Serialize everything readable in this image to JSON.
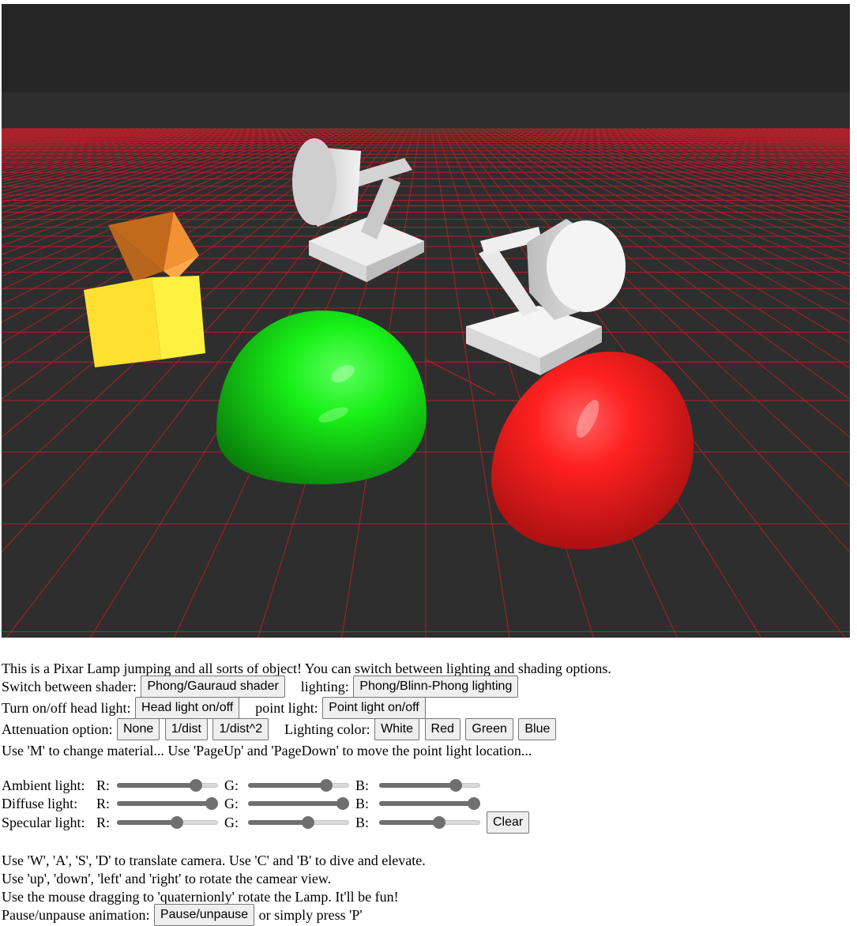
{
  "intro": "This is a Pixar Lamp jumping and all sorts of object! You can switch between lighting and shading options.",
  "shader": {
    "label": "Switch between shader:",
    "button": "Phong/Gauraud shader",
    "lighting_label": "lighting:",
    "lighting_button": "Phong/Blinn-Phong lighting"
  },
  "lights": {
    "head_label": "Turn on/off head light:",
    "head_button": "Head light on/off",
    "point_label": "point light:",
    "point_button": "Point light on/off"
  },
  "attenuation": {
    "label": "Attenuation option:",
    "options": [
      "None",
      "1/dist",
      "1/dist^2"
    ],
    "color_label": "Lighting color:",
    "colors": [
      "White",
      "Red",
      "Green",
      "Blue"
    ]
  },
  "material_hint": "Use 'M' to change material... Use 'PageUp' and 'PageDown' to move the point light location...",
  "sliders": {
    "rows": [
      {
        "label": "Ambient light:",
        "channels": [
          {
            "name": "R:",
            "value": 0.78
          },
          {
            "name": "G:",
            "value": 0.77
          },
          {
            "name": "B:",
            "value": 0.76
          }
        ]
      },
      {
        "label": "Diffuse light:",
        "channels": [
          {
            "name": "R:",
            "value": 0.94
          },
          {
            "name": "G:",
            "value": 0.94
          },
          {
            "name": "B:",
            "value": 0.94
          }
        ]
      },
      {
        "label": "Specular light:",
        "channels": [
          {
            "name": "R:",
            "value": 0.59
          },
          {
            "name": "G:",
            "value": 0.59
          },
          {
            "name": "B:",
            "value": 0.59
          }
        ]
      }
    ],
    "clear_button": "Clear"
  },
  "help": {
    "camera": "Use 'W', 'A', 'S', 'D' to translate camera. Use 'C' and 'B' to dive and elevate.",
    "rotate": "Use 'up', 'down', 'left' and 'right' to rotate the camear view.",
    "mouse": "Use the mouse dragging to 'quaternionly' rotate the Lamp. It'll be fun!",
    "pause_label": "Pause/unpause animation:",
    "pause_button": "Pause/unpause",
    "pause_suffix": "or simply press 'P'"
  },
  "colors": {
    "sky": "#262626",
    "floor": "#2e2e2e",
    "grid": "#c4202a",
    "green_sphere": "#12e612",
    "red_sphere": "#e01818",
    "cube": "#ffe031",
    "pyramid": "#f39233",
    "lamp": "#e6e6e6"
  }
}
